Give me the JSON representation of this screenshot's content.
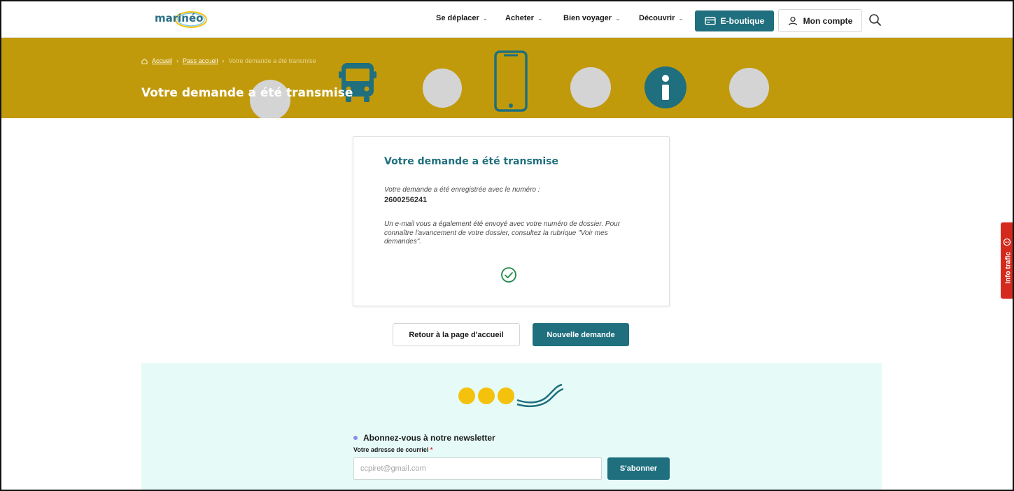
{
  "header": {
    "nav": [
      {
        "label": "Se déplacer"
      },
      {
        "label": "Acheter"
      },
      {
        "label": "Bien voyager"
      },
      {
        "label": "Découvrir"
      }
    ],
    "eboutique_label": "E-boutique",
    "account_label": "Mon compte",
    "search_icon": "search-icon"
  },
  "hero": {
    "breadcrumb": {
      "home": "Accueil",
      "parent": "Pass accueil",
      "current": "Votre demande a été transmise"
    },
    "title": "Votre demande a été transmise"
  },
  "card": {
    "title": "Votre demande a été transmise",
    "intro": "Votre demande a été enregistrée avec le numéro :",
    "number": "2600256241",
    "info": "Un e-mail vous a également été envoyé avec votre numéro de dossier. Pour connaître l'avancement de votre dossier, consultez la rubrique \"Voir mes demandes\"."
  },
  "actions": {
    "back_label": "Retour à la page d'accueil",
    "new_label": "Nouvelle demande"
  },
  "newsletter": {
    "heading": "Abonnez-vous à notre newsletter",
    "email_label": "Votre adresse de courriel",
    "email_required_mark": "*",
    "email_value": "ccpiret@gmail.com",
    "subscribe_label": "S'abonner"
  },
  "info_trafic": {
    "label": "Info trafic"
  },
  "colors": {
    "teal": "#1f6f7e",
    "hero_gold": "#c19a0c",
    "newsletter_bg": "#e6fbf7",
    "traffic_red": "#d42a1e",
    "yellow_dots": "#f4c20d"
  }
}
